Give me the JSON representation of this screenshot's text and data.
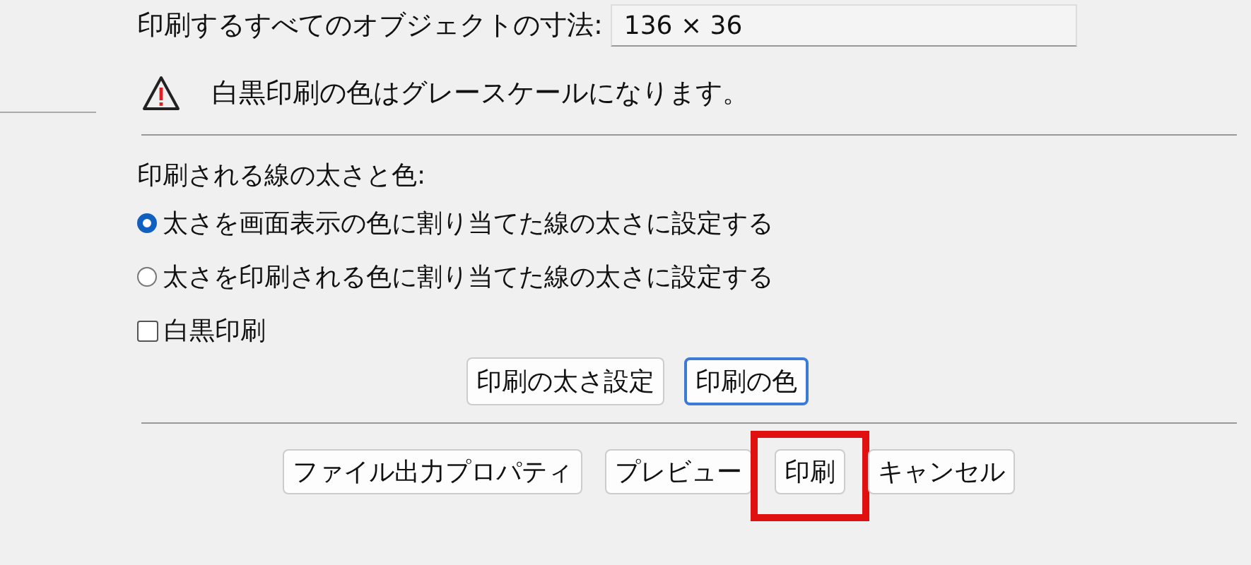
{
  "dimensions": {
    "label": "印刷するすべてのオブジェクトの寸法:",
    "value": "136 × 36"
  },
  "warning": {
    "text": "白黒印刷の色はグレースケールになります。"
  },
  "line_settings": {
    "heading": "印刷される線の太さと色:",
    "options": [
      {
        "label": "太さを画面表示の色に割り当てた線の太さに設定する",
        "selected": true
      },
      {
        "label": "太さを印刷される色に割り当てた線の太さに設定する",
        "selected": false
      }
    ],
    "monochrome": {
      "label": "白黒印刷",
      "checked": false
    },
    "buttons": [
      {
        "label": "印刷の太さ設定",
        "focused": false
      },
      {
        "label": "印刷の色",
        "focused": true
      }
    ]
  },
  "footer_buttons": [
    {
      "label": "ファイル出力プロパティ",
      "highlighted": false
    },
    {
      "label": "プレビュー",
      "highlighted": false
    },
    {
      "label": "印刷",
      "highlighted": true
    },
    {
      "label": "キャンセル",
      "highlighted": false
    }
  ]
}
